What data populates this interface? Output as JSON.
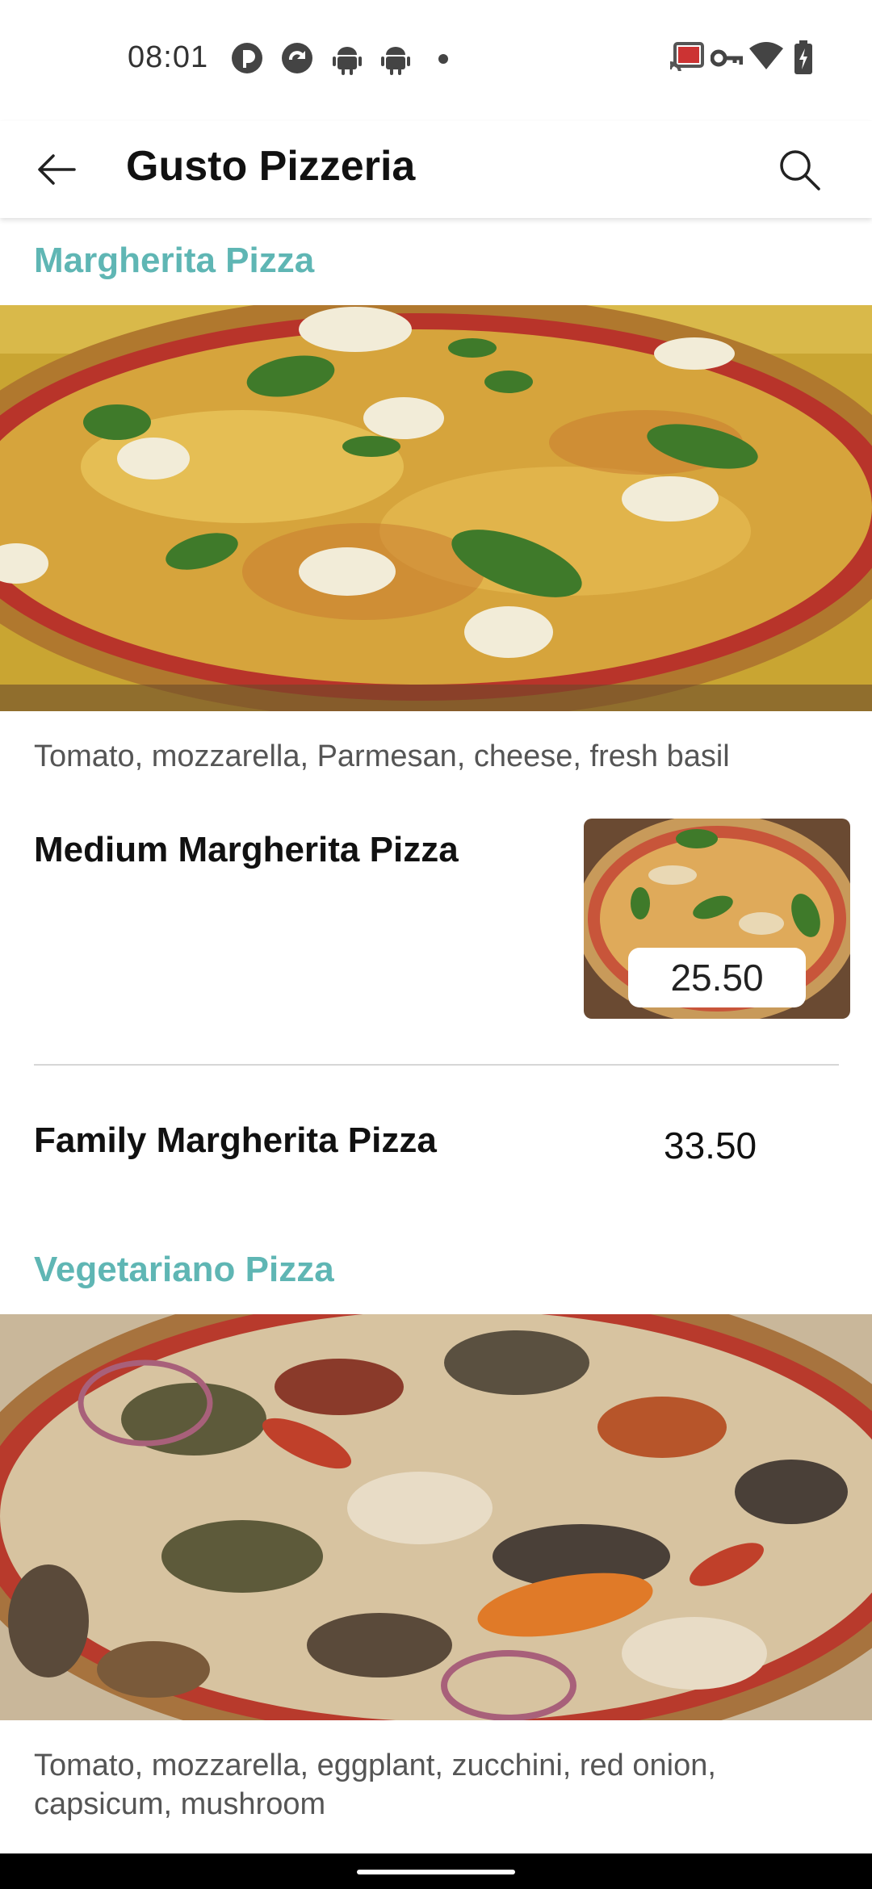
{
  "status_bar": {
    "time": "08:01",
    "left_icons": [
      "pocket-casts-icon",
      "sync-app-icon",
      "android-icon",
      "android-icon",
      "dot-icon"
    ],
    "right_icons": [
      "cast-icon",
      "vpn-key-icon",
      "wifi-icon",
      "battery-charging-icon"
    ]
  },
  "header": {
    "title": "Gusto Pizzeria",
    "back_icon": "arrow-back-icon",
    "search_icon": "search-icon"
  },
  "sections": [
    {
      "title": "Margherita Pizza",
      "description": "Tomato, mozzarella, Parmesan, cheese, fresh basil",
      "items": [
        {
          "name": "Medium Margherita Pizza",
          "price": "25.50"
        },
        {
          "name": "Family Margherita Pizza",
          "price": "33.50"
        }
      ]
    },
    {
      "title": "Vegetariano Pizza",
      "description": "Tomato, mozzarella, eggplant, zucchini, red onion, capsicum, mushroom"
    }
  ],
  "colors": {
    "accent": "#5fb6b4",
    "text": "#111111",
    "secondary_text": "#555555",
    "divider": "#d6d6d6"
  }
}
